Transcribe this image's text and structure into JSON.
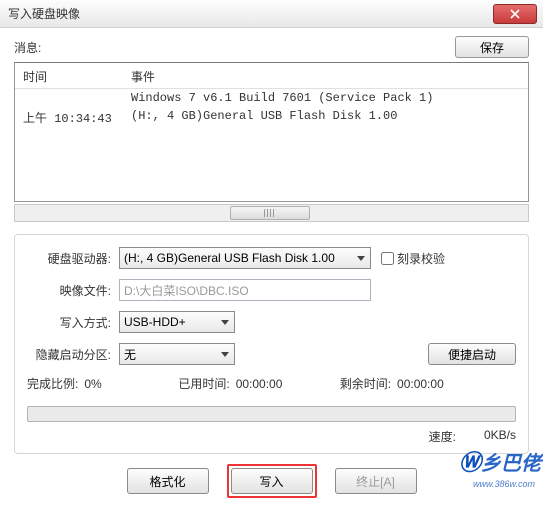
{
  "window": {
    "title": "写入硬盘映像"
  },
  "topbar": {
    "message_label": "消息:",
    "save_label": "保存"
  },
  "log": {
    "headers": {
      "time": "时间",
      "event": "事件"
    },
    "rows": [
      {
        "time": "",
        "event": "Windows 7 v6.1 Build 7601 (Service Pack 1)"
      },
      {
        "time": "上午 10:34:43",
        "event": "(H:, 4 GB)General USB Flash Disk  1.00"
      }
    ]
  },
  "form": {
    "drive_label": "硬盘驱动器:",
    "drive_value": "(H:, 4 GB)General USB Flash Disk  1.00",
    "verify_label": "刻录校验",
    "image_label": "映像文件:",
    "image_value": "D:\\大白菜ISO\\DBC.ISO",
    "write_mode_label": "写入方式:",
    "write_mode_value": "USB-HDD+",
    "hide_label": "隐藏启动分区:",
    "hide_value": "无",
    "portable_label": "便捷启动"
  },
  "status": {
    "complete_label": "完成比例:",
    "complete_value": "0%",
    "elapsed_label": "已用时间:",
    "elapsed_value": "00:00:00",
    "remain_label": "剩余时间:",
    "remain_value": "00:00:00",
    "speed_label": "速度:",
    "speed_value": "0KB/s"
  },
  "footer": {
    "format_label": "格式化",
    "write_label": "写入",
    "abort_label": "终止[A]"
  },
  "watermark": {
    "text": "乡巴佬",
    "url": "www.386w.com"
  }
}
